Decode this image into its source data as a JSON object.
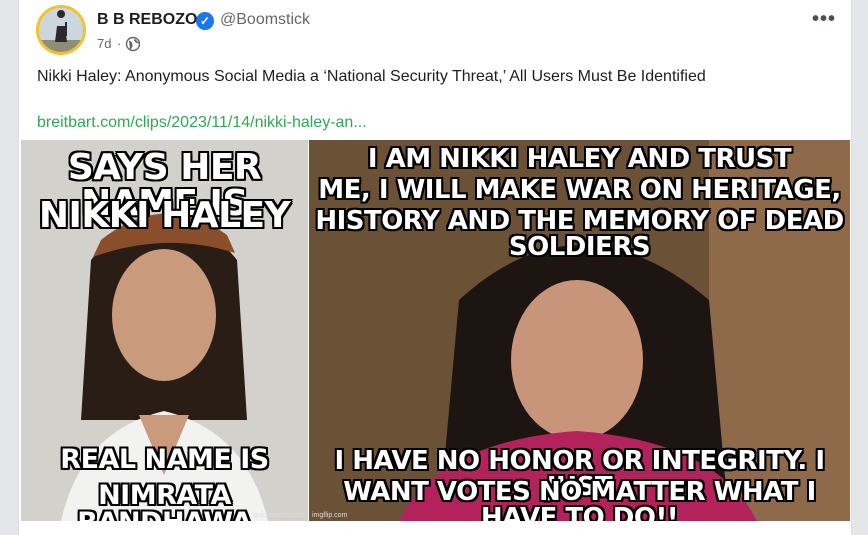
{
  "post": {
    "author": "B B REBOZO",
    "handle": "@Boomstick",
    "time": "7d",
    "separator": "·",
    "privacy_icon": "globe-icon",
    "more_label": "•••",
    "verified_mark": "✓",
    "text": "Nikki Haley: Anonymous Social Media a ‘National Security Threat,’ All Users Must Be Identified",
    "link": "breitbart.com/clips/2023/11/14/nikki-haley-an..."
  },
  "images": {
    "left": {
      "top_line1": "SAYS HER NAME IS",
      "top_line2": "NIKKI HALEY",
      "bottom_line1": "REAL NAME IS",
      "bottom_line2": "NIMRATA  RANDHAWA",
      "watermark": "quickmeme.com"
    },
    "right": {
      "top_line1": "I AM NIKKI HALEY AND TRUST",
      "top_line2": "ME, I WILL MAKE WAR ON HERITAGE,",
      "top_line3": "HISTORY AND THE MEMORY OF DEAD SOLDIERS",
      "bottom_line1": "I HAVE NO HONOR OR INTEGRITY. I JUST",
      "bottom_line2": "WANT VOTES NO MATTER WHAT I HAVE TO DO!!",
      "watermark": "imgflip.com"
    }
  },
  "colors": {
    "link": "#32a852",
    "verified": "#1877f2",
    "avatar_ring": "#f2c230"
  }
}
